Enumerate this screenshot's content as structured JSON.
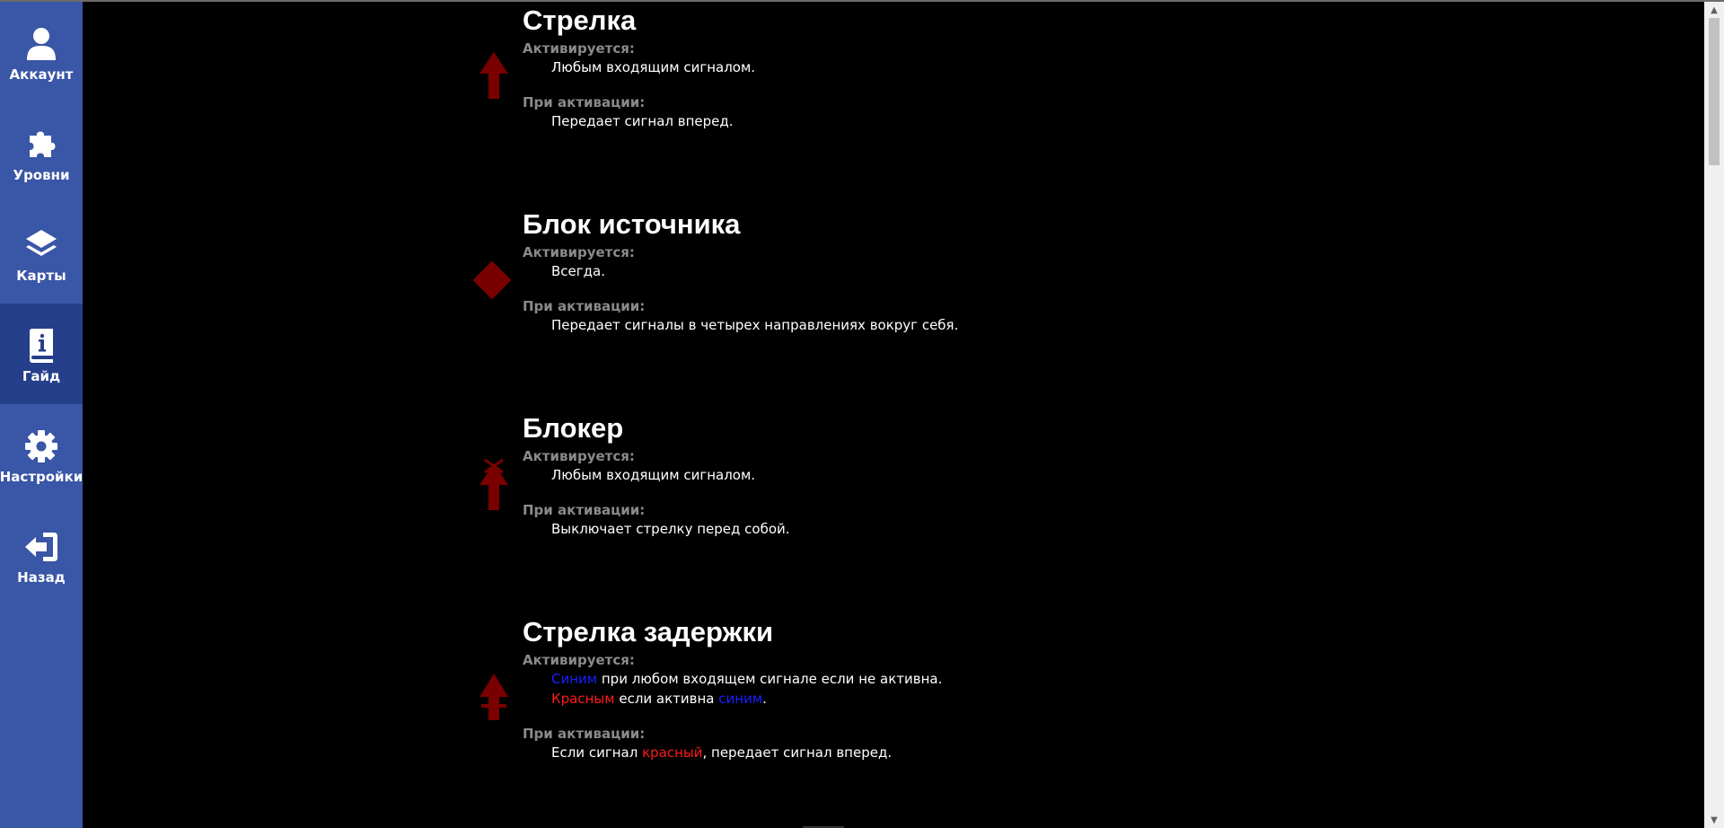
{
  "sidebar": {
    "items": [
      {
        "label": "Аккаунт",
        "icon": "user-icon"
      },
      {
        "label": "Уровни",
        "icon": "puzzle-icon"
      },
      {
        "label": "Карты",
        "icon": "layers-icon"
      },
      {
        "label": "Гайд",
        "icon": "guide-book-icon",
        "active": true
      },
      {
        "label": "Настройки",
        "icon": "gear-icon"
      },
      {
        "label": "Назад",
        "icon": "exit-icon"
      }
    ]
  },
  "colors": {
    "sidebar_bg": "#3a56a6",
    "sidebar_active": "#263f8a",
    "icon_dark_red": "#7a0000",
    "blue_text": "#1a20ff",
    "red_text": "#ff1a1a"
  },
  "guide": {
    "activates_label": "Активируется:",
    "on_activate_label": "При активации:",
    "entries": [
      {
        "title": "Стрелка",
        "icon": "arrow-up-icon",
        "activates": "Любым входящим сигналом.",
        "on_activate": "Передает сигнал вперед."
      },
      {
        "title": "Блок источника",
        "icon": "diamond-icon",
        "activates": "Всегда.",
        "on_activate": "Передает сигналы в четырех направлениях вокруг себя."
      },
      {
        "title": "Блокер",
        "icon": "blocker-arrow-icon",
        "activates": "Любым входящим сигналом.",
        "on_activate": "Выключает стрелку перед собой."
      },
      {
        "title": "Стрелка задержки",
        "icon": "delay-arrow-icon",
        "activates_line1": {
          "colored": "Синим",
          "rest": " при любом входящем сигнале если не активна."
        },
        "activates_line2": {
          "colored": "Красным",
          "middle": " если активна ",
          "colored2": "синим",
          "end": "."
        },
        "on_activate": {
          "pre": "Если сигнал ",
          "colored": "красный",
          "post": ", передает сигнал вперед."
        }
      }
    ]
  }
}
